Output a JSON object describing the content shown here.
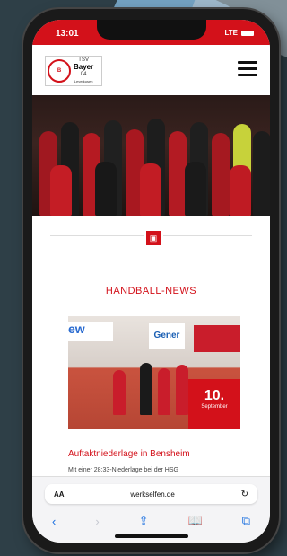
{
  "status": {
    "time": "13:01",
    "signal": "LTE"
  },
  "header": {
    "logo_small": "TSV",
    "logo_brand": "Bayer",
    "logo_number": "04",
    "logo_sub": "Leverkusen"
  },
  "section": {
    "title": "HANDBALL-NEWS"
  },
  "news": {
    "ad_1": "ew",
    "ad_2": "Gener",
    "date_day": "10.",
    "date_month": "September",
    "title": "Auftaktniederlage in Bensheim",
    "teaser": "Mit einer 28:33-Niederlage bei der HSG"
  },
  "browser": {
    "aa_label": "AA",
    "url": "werkselfen.de",
    "reload_icon": "reload-icon",
    "nav": [
      "back-icon",
      "forward-icon",
      "share-icon",
      "bookmarks-icon",
      "tabs-icon"
    ]
  },
  "colors": {
    "brand_red": "#d3111a",
    "background": "#2e3f47"
  }
}
